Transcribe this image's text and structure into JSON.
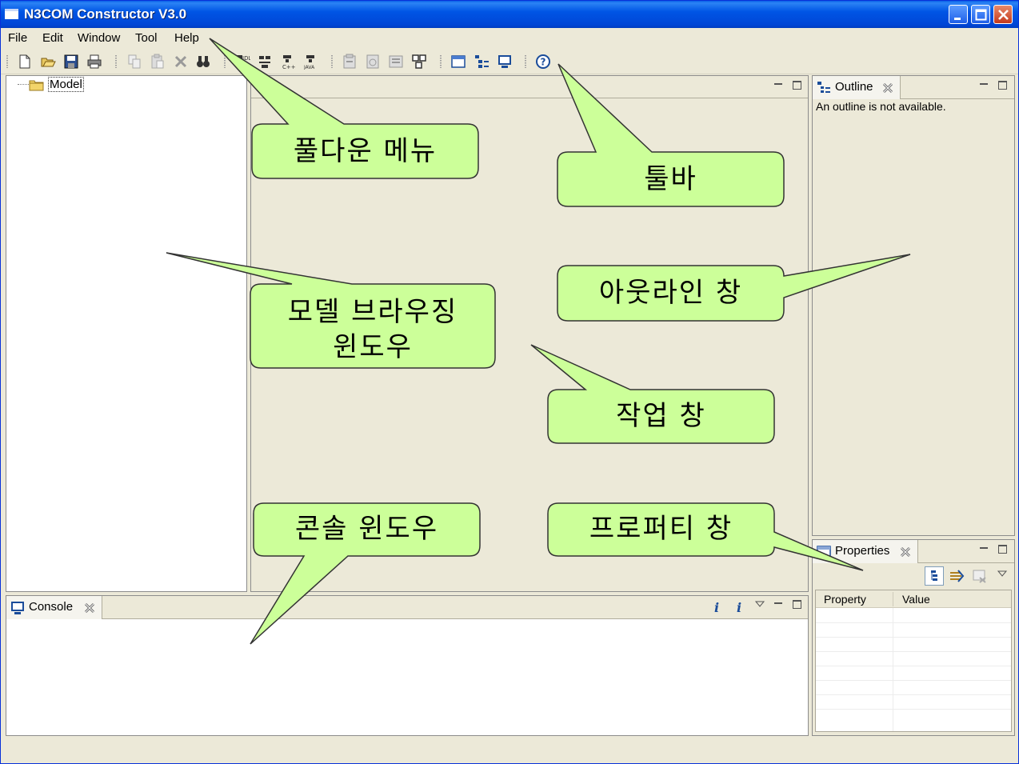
{
  "window": {
    "title": "N3COM Constructor V3.0"
  },
  "menu": {
    "items": [
      "File",
      "Edit",
      "Window",
      "Tool",
      "Help"
    ]
  },
  "toolbar": {
    "icons": [
      "new-file-icon",
      "open-folder-icon",
      "save-icon",
      "print-icon",
      "copy-icon",
      "paste-icon",
      "delete-icon",
      "find-icon",
      "generate-idl-icon",
      "generate-code-icon",
      "generate-cpp-icon",
      "generate-java-icon",
      "import-icon",
      "export-icon",
      "layout-icon",
      "diagram-icon",
      "model-view-icon",
      "outline-view-icon",
      "console-view-icon",
      "help-icon"
    ]
  },
  "tree": {
    "root_label": "Model"
  },
  "outline": {
    "tab_label": "Outline",
    "message": "An outline is not available."
  },
  "properties": {
    "tab_label": "Properties",
    "columns": [
      "Property",
      "Value"
    ]
  },
  "console": {
    "tab_label": "Console"
  },
  "callouts": {
    "pulldown_menu": "풀다운 메뉴",
    "toolbar": "툴바",
    "model_browsing_line1": "모델 브라우징",
    "model_browsing_line2": "윈도우",
    "outline_window": "아웃라인 창",
    "work_window": "작업 창",
    "console_window": "콘솔 윈도우",
    "property_window": "프로퍼티 창"
  },
  "colors": {
    "callout_fill": "#ccff99",
    "titlebar": "#0055e5",
    "workspace": "#ece9d8"
  }
}
